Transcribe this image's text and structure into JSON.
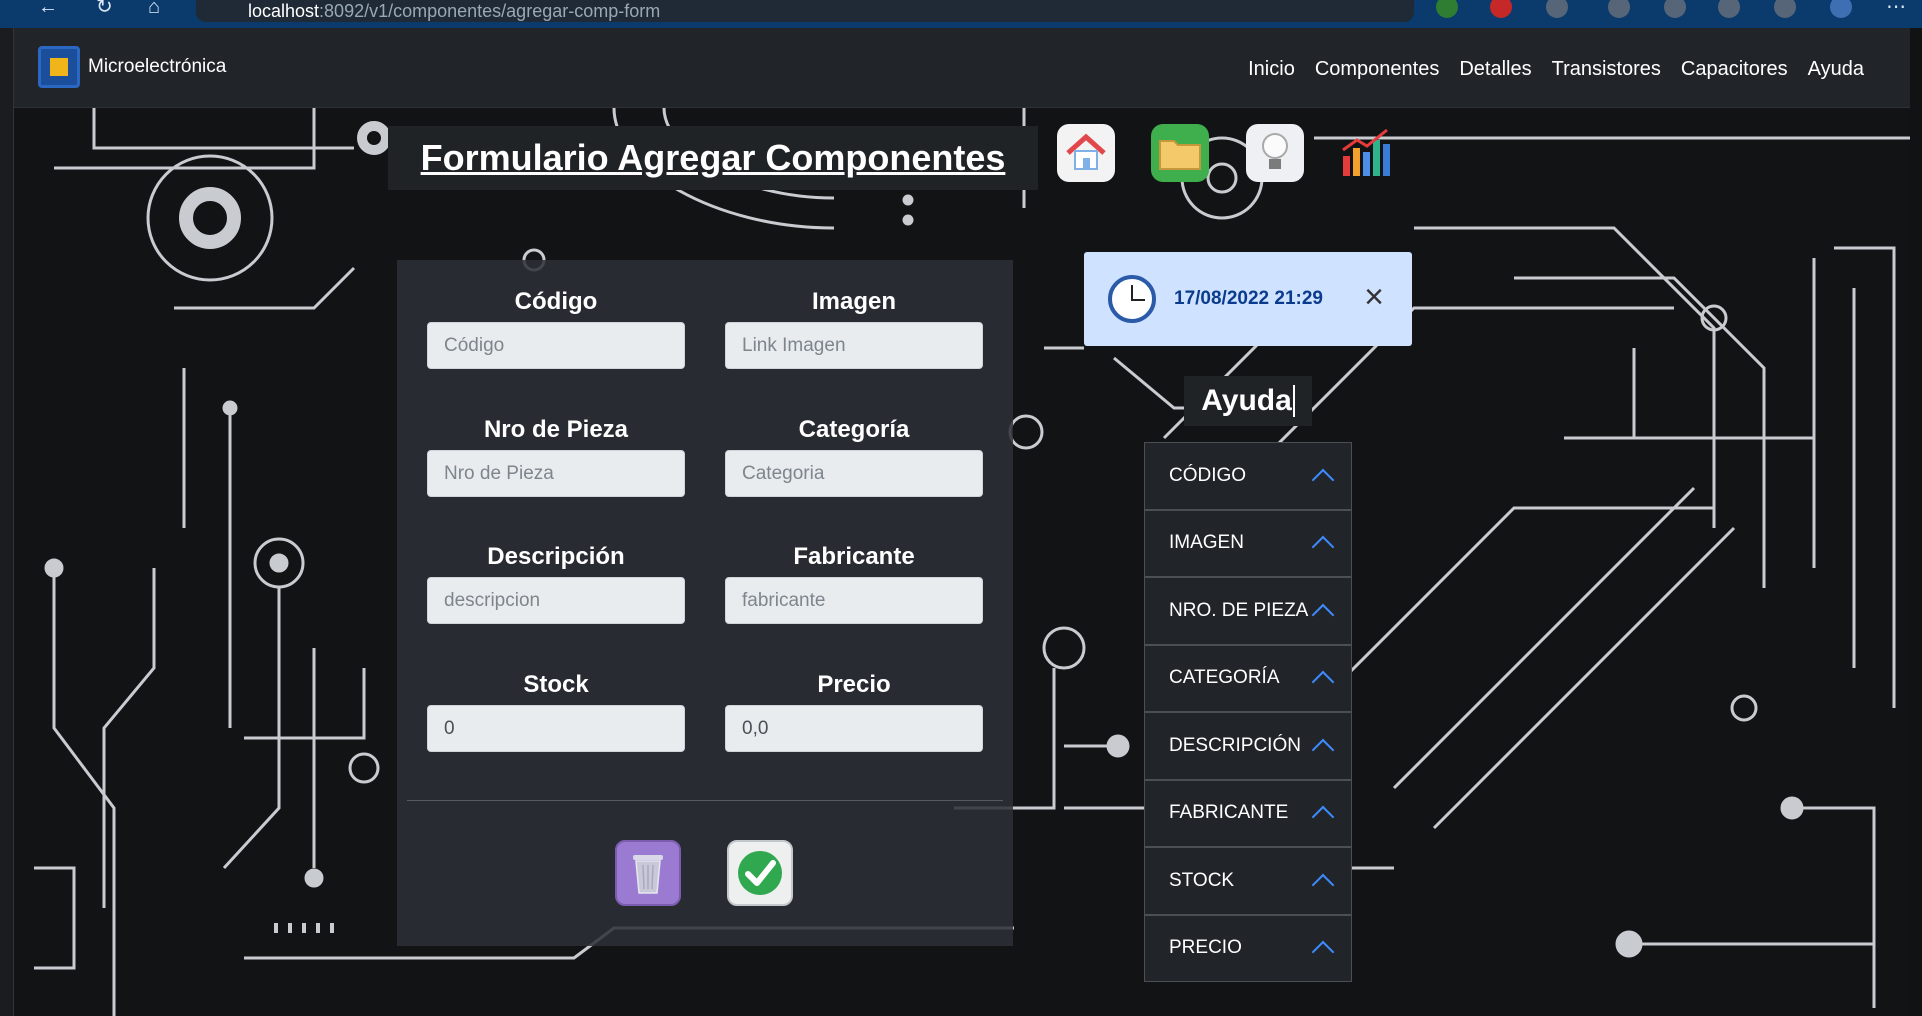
{
  "browser": {
    "url_host": "localhost",
    "url_path": ":8092/v1/componentes/agregar-comp-form"
  },
  "navbar": {
    "brand": "Microelectrónica",
    "links": [
      "Inicio",
      "Componentes",
      "Detalles",
      "Transistores",
      "Capacitores",
      "Ayuda"
    ]
  },
  "page": {
    "title": "Formulario Agregar Componentes"
  },
  "icon_tiles": [
    "home-icon",
    "folder-icon",
    "lightbulb-icon",
    "chart-icon"
  ],
  "form": {
    "fields": [
      {
        "label": "Código",
        "placeholder": "Código",
        "value": ""
      },
      {
        "label": "Imagen",
        "placeholder": "Link Imagen",
        "value": ""
      },
      {
        "label": "Nro de Pieza",
        "placeholder": "Nro de Pieza",
        "value": ""
      },
      {
        "label": "Categoría",
        "placeholder": "Categoria",
        "value": ""
      },
      {
        "label": "Descripción",
        "placeholder": "descripcion",
        "value": ""
      },
      {
        "label": "Fabricante",
        "placeholder": "fabricante",
        "value": ""
      },
      {
        "label": "Stock",
        "placeholder": "",
        "value": "0"
      },
      {
        "label": "Precio",
        "placeholder": "",
        "value": "0,0"
      }
    ],
    "buttons": [
      "trash-icon",
      "check-icon"
    ]
  },
  "toast": {
    "datetime": "17/08/2022 21:29",
    "icon": "clock-icon",
    "close": "×"
  },
  "help": {
    "title": "Ayuda",
    "items": [
      "CÓDIGO",
      "IMAGEN",
      "NRO. DE PIEZA",
      "CATEGORÍA",
      "DESCRIPCIÓN",
      "FABRICANTE",
      "STOCK",
      "PRECIO"
    ]
  },
  "colors": {
    "navbar": "#212529",
    "accent": "#3d8bfd",
    "toast": "#cfe2ff"
  }
}
